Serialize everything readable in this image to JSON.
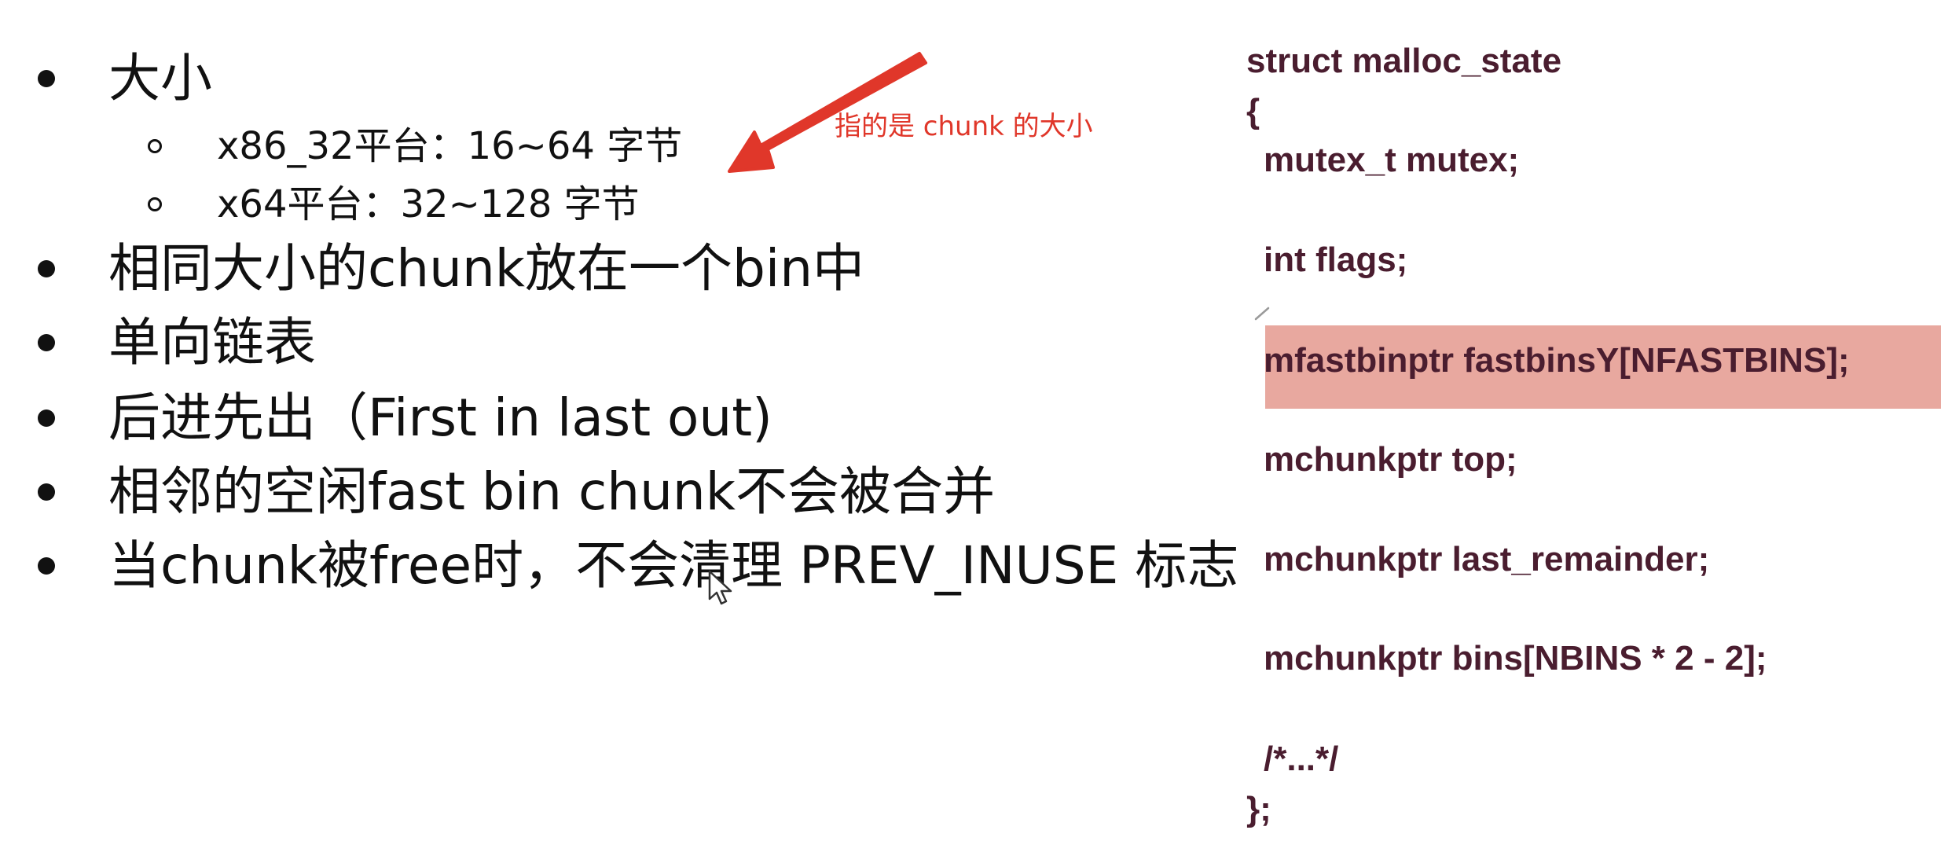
{
  "bullets": [
    {
      "text": "大小",
      "children": [
        {
          "text": "x86_32平台：16~64 字节"
        },
        {
          "text": "x64平台：32~128 字节"
        }
      ]
    },
    {
      "text": "相同大小的chunk放在一个bin中"
    },
    {
      "text": "单向链表"
    },
    {
      "text": "后进先出（First in last out)"
    },
    {
      "text": "相邻的空闲fast bin chunk不会被合并"
    },
    {
      "text": "当chunk被free时，不会清理 PREV_INUSE 标志"
    }
  ],
  "annotation": {
    "text": "指的是 chunk 的大小",
    "color": "#e0372a"
  },
  "code": {
    "lines": [
      "struct malloc_state",
      "{",
      "mutex_t mutex;",
      "int flags;",
      "mfastbinptr fastbinsY[NFASTBINS];",
      "mchunkptr top;",
      "mchunkptr last_remainder;",
      "mchunkptr bins[NBINS * 2 - 2];",
      "/*...*/",
      "};"
    ],
    "highlighted_line": "mfastbinptr fastbinsY[NFASTBINS];",
    "text_color": "#4a1d2f",
    "highlight_color": "#e8a89f"
  },
  "icons": {
    "bullet": "filled-dot-bullet-icon",
    "sub_bullet": "hollow-circle-bullet-icon",
    "arrow": "red-arrow-icon",
    "cursor": "mouse-pointer-icon",
    "pencil": "pencil-mark-icon"
  }
}
